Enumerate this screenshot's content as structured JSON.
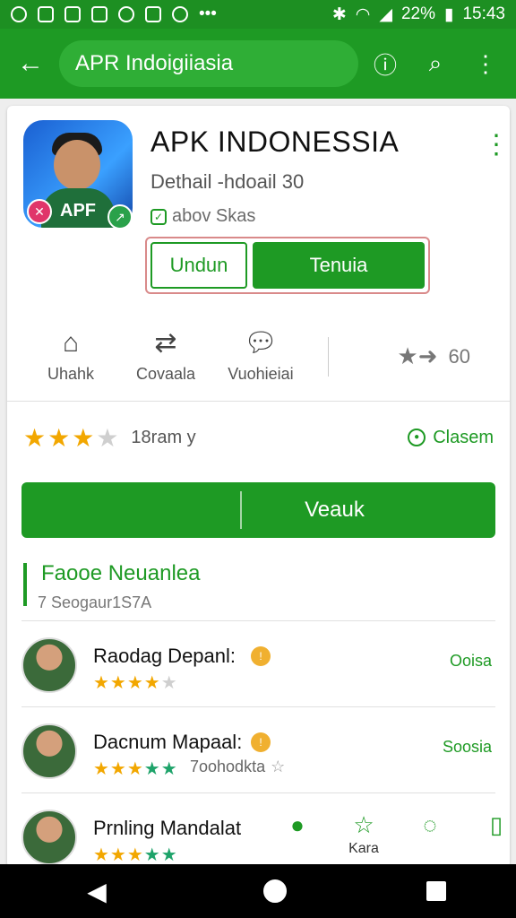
{
  "status_bar": {
    "battery": "22%",
    "time": "15:43"
  },
  "app_bar": {
    "search_text": "APR Indoigiiasia"
  },
  "app": {
    "title": "APK INDONESSIA",
    "subtitle": "Dethail -hdoail 30",
    "verified_text": "abov Skas",
    "icon_label": "APF",
    "buttons": {
      "outline": "Undun",
      "solid": "Tenuia"
    }
  },
  "stats": {
    "items": [
      {
        "icon": "home-icon",
        "label": "Uhahk"
      },
      {
        "icon": "swap-icon",
        "label": "Covaala"
      },
      {
        "icon": "chat-icon",
        "label": "Vuohieiai"
      }
    ],
    "rating_value": "60"
  },
  "rating": {
    "stars_filled": 3,
    "stars_total": 4,
    "text": "18ram y",
    "action": "Clasem"
  },
  "primary_button": {
    "label": "Veauk"
  },
  "section": {
    "title": "Faooe Neuanlea",
    "subtitle": "7 Seogaur1S7A"
  },
  "reviews": [
    {
      "name": "Raodag Depanl:",
      "action": "Ooisa",
      "stars": 4
    },
    {
      "name": "Dacnum Mapaal:",
      "action": "Soosia",
      "stars": 5,
      "extra": "7oohodkta"
    },
    {
      "name": "Prnling Mandalat",
      "stars": 5,
      "icon_label": "Kara"
    }
  ],
  "colors": {
    "primary": "#1e9a24",
    "status_bar": "#1d8f22",
    "star": "#f2a700"
  }
}
